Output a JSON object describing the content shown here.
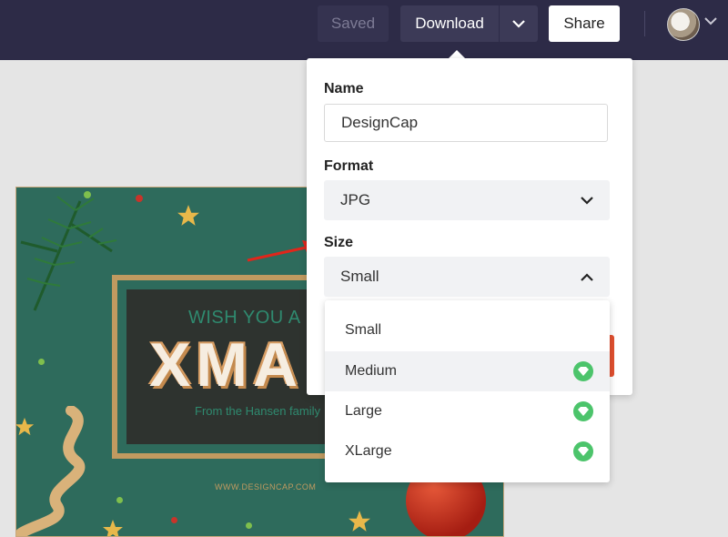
{
  "toolbar": {
    "saved_label": "Saved",
    "download_label": "Download",
    "share_label": "Share"
  },
  "card": {
    "wish_text": "WISH YOU A ME",
    "xmas_text": "XMA",
    "from_text": "From the Hansen family",
    "website_text": "WWW.DESIGNCAP.COM"
  },
  "popup": {
    "name_label": "Name",
    "name_value": "DesignCap",
    "format_label": "Format",
    "format_value": "JPG",
    "size_label": "Size",
    "size_value": "Small"
  },
  "size_options": [
    {
      "label": "Small",
      "premium": false
    },
    {
      "label": "Medium",
      "premium": true
    },
    {
      "label": "Large",
      "premium": true
    },
    {
      "label": "XLarge",
      "premium": true
    }
  ],
  "colors": {
    "topbar": "#2d2b47",
    "premium_badge": "#4cc46b",
    "annotation_arrow": "#e0261b",
    "card_background": "#2e6b5c"
  },
  "icons": {
    "download_caret": "chevron-down-icon",
    "format_caret": "chevron-down-icon",
    "size_caret": "chevron-up-icon",
    "premium": "diamond-icon"
  }
}
